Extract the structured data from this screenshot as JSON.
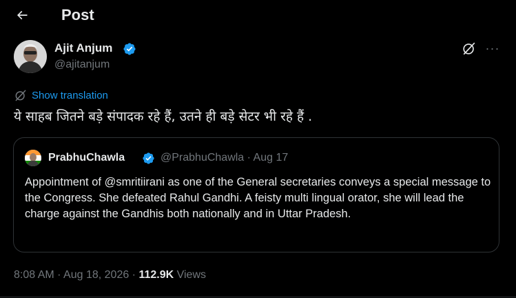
{
  "header": {
    "title": "Post",
    "back_icon": "arrow-left-icon"
  },
  "author": {
    "name": "Ajit Anjum",
    "handle": "@ajitanjum",
    "verified_color": "#1d9bf0"
  },
  "actions": {
    "grok_icon": "grok-icon",
    "more_icon": "more-horizontal-icon",
    "more_label": "···"
  },
  "translation": {
    "label": "Show translation",
    "icon": "translate-icon"
  },
  "tweet": {
    "text": "ये साहब जितने बड़े संपादक रहे हैं,  उतने ही बड़े सेटर भी रहे हैं ."
  },
  "quote": {
    "name": "PrabhuChawla",
    "handle_date": "@PrabhuChawla · Aug 17",
    "text": "Appointment of @smritiirani  as one of the General secretaries conveys a special message to the Congress. She defeated Rahul Gandhi. A feisty multi lingual orator, she will lead the charge against the Gandhis both nationally and in Uttar Pradesh."
  },
  "meta": {
    "time_date": "8:08 AM · Aug 18, 2026 · ",
    "views_count": "112.9K",
    "views_label": " Views"
  },
  "colors": {
    "accent": "#1d9bf0",
    "muted": "#71767b",
    "text": "#e7e9ea",
    "border": "#2f3336"
  }
}
